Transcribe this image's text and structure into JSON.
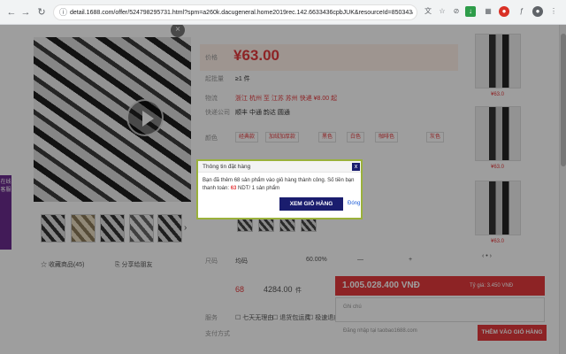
{
  "browser": {
    "url": "detail.1688.com/offer/524798295731.html?spm=a260k.dacugeneral.home2019rec.142.6633436cpbJUK&resourceId=850343&udsPoolI..."
  },
  "product": {
    "price_label": "价格",
    "price": "¥63.00",
    "info": [
      {
        "label": "起批量",
        "value": "≥1 件"
      },
      {
        "label": "物流",
        "value": "浙江 杭州 至 江苏 苏州 快递 ¥8.00 起"
      },
      {
        "label": "快递公司",
        "value": "顺丰 中通 韵达 圆通"
      }
    ],
    "option_label": "颜色",
    "options": [
      "经典款",
      "加绒加厚款",
      "黑色",
      "白色",
      "咖啡色",
      "灰色"
    ],
    "fav_label": "收藏商品(45)",
    "share_label": "分享给朋友",
    "size_label": "尺码",
    "row": {
      "name": "均码",
      "stock": "60.00%",
      "price": "4284.00",
      "unit": "件"
    },
    "qty": "68",
    "service_label": "服务",
    "service_opts": [
      "七天无理由",
      "退货包运费",
      "极速退款"
    ],
    "pay_label": "支付方式"
  },
  "side": {
    "prices": [
      "¥63.0",
      "¥63.0",
      "¥63.0"
    ]
  },
  "left_tab": {
    "label": "在线客服"
  },
  "cart": {
    "total": "1.005.028.400 VNĐ",
    "rate": "Tỷ giá: 3.450 VNĐ",
    "note_label": "Ghi chú",
    "login_text": "Đăng nhập tại taobao1688.com",
    "add_button": "THÊM VÀO GIỎ HÀNG"
  },
  "dialog": {
    "title": "Thông tin đặt hàng",
    "msg_pre": "Bạn đã thêm 68 sản phẩm vào giỏ hàng thành công. Số tiền bạn thanh toán: ",
    "msg_amount": "63",
    "msg_post": " NDT/ 1 sản phẩm",
    "view_cart": "XEM GIỎ HÀNG",
    "close_link": "Đóng",
    "close_symbol": "x"
  }
}
